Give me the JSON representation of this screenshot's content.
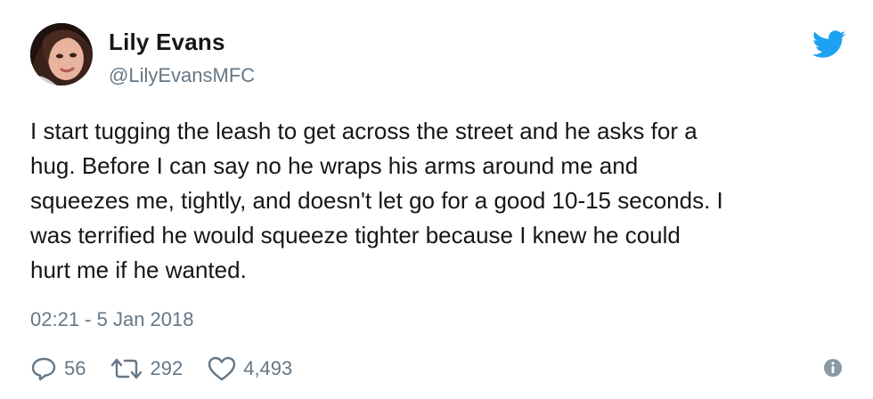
{
  "user": {
    "name": "Lily Evans",
    "handle": "@LilyEvansMFC"
  },
  "tweet": {
    "text": "I start tugging the leash to get across the street and he asks for a\nhug. Before I can say no he wraps his arms around me and\nsqueezes me, tightly, and doesn't let go for a good 10-15 seconds. I\nwas terrified he would squeeze tighter because I knew he could\nhurt me if he wanted.",
    "timestamp": "02:21 - 5 Jan 2018"
  },
  "actions": {
    "replies": "56",
    "retweets": "292",
    "likes": "4,493"
  },
  "icons": {
    "brand": "twitter-bird-icon",
    "reply": "reply-icon",
    "retweet": "retweet-icon",
    "like": "heart-icon",
    "info": "info-icon"
  },
  "colors": {
    "twitter_blue": "#1da1f2",
    "secondary_text": "#657786",
    "primary_text": "#14171a"
  }
}
